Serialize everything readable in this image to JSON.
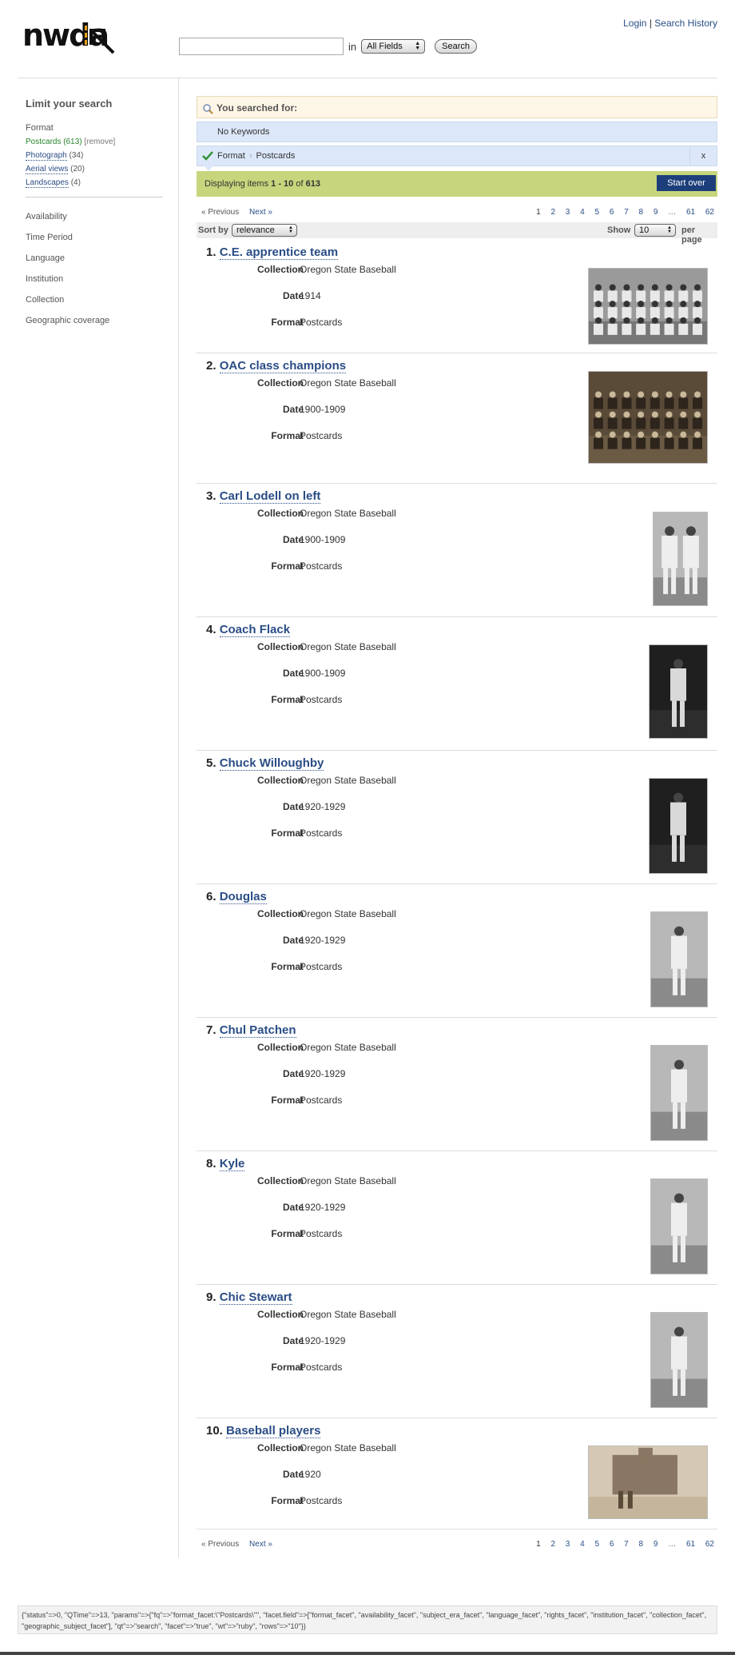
{
  "header": {
    "logo_text": "nwda",
    "search": {
      "value": "",
      "in_label": "in",
      "field": "All Fields",
      "button": "Search"
    },
    "login": "Login",
    "separator": "|",
    "history": "Search History"
  },
  "sidebar": {
    "title": "Limit your search",
    "format": {
      "heading": "Format",
      "items": [
        {
          "label": "Postcards",
          "count": "(613)",
          "remove": "[remove]"
        },
        {
          "label": "Photograph",
          "count": "(34)"
        },
        {
          "label": "Aerial views",
          "count": "(20)"
        },
        {
          "label": "Landscapes",
          "count": "(4)"
        }
      ]
    },
    "other": [
      "Availability",
      "Time Period",
      "Language",
      "Institution",
      "Collection",
      "Geographic coverage"
    ]
  },
  "constraints": {
    "searched_for": "You searched for:",
    "keywords": "No Keywords",
    "facet_name": "Format",
    "facet_value": "Postcards",
    "remove_x": "x",
    "display_prefix": "Displaying items ",
    "display_range": "1 - 10",
    "display_of": " of ",
    "display_total": "613",
    "start_over": "Start over"
  },
  "pager": {
    "prev": "« Previous",
    "next": "Next »",
    "pages": [
      "1",
      "2",
      "3",
      "4",
      "5",
      "6",
      "7",
      "8",
      "9",
      "…",
      "61",
      "62"
    ]
  },
  "sort": {
    "label": "Sort by",
    "value": "relevance",
    "show": "Show",
    "per_value": "10",
    "per_label": "per page"
  },
  "field_labels": {
    "collection": "Collection",
    "date": "Date",
    "format": "Format"
  },
  "results": [
    {
      "num": "1.",
      "title": "C.E. apprentice team",
      "collection": "Oregon State Baseball",
      "date": "1914",
      "format": "Postcards",
      "thumb": "team-photo"
    },
    {
      "num": "2.",
      "title": "OAC class champions",
      "collection": "Oregon State Baseball",
      "date": "1900-1909",
      "format": "Postcards",
      "thumb": "team-photo-sepia"
    },
    {
      "num": "3.",
      "title": "Carl Lodell on left",
      "collection": "Oregon State Baseball",
      "date": "1900-1909",
      "format": "Postcards",
      "thumb": "two-players"
    },
    {
      "num": "4.",
      "title": "Coach Flack",
      "collection": "Oregon State Baseball",
      "date": "1900-1909",
      "format": "Postcards",
      "thumb": "player-dark"
    },
    {
      "num": "5.",
      "title": "Chuck Willoughby",
      "collection": "Oregon State Baseball",
      "date": "1920-1929",
      "format": "Postcards",
      "thumb": "player-dark"
    },
    {
      "num": "6.",
      "title": "Douglas",
      "collection": "Oregon State Baseball",
      "date": "1920-1929",
      "format": "Postcards",
      "thumb": "player-light"
    },
    {
      "num": "7.",
      "title": "Chul Patchen",
      "collection": "Oregon State Baseball",
      "date": "1920-1929",
      "format": "Postcards",
      "thumb": "player-light"
    },
    {
      "num": "8.",
      "title": "Kyle",
      "collection": "Oregon State Baseball",
      "date": "1920-1929",
      "format": "Postcards",
      "thumb": "player-light"
    },
    {
      "num": "9.",
      "title": "Chic Stewart",
      "collection": "Oregon State Baseball",
      "date": "1920-1929",
      "format": "Postcards",
      "thumb": "player-light"
    },
    {
      "num": "10.",
      "title": "Baseball players",
      "collection": "Oregon State Baseball",
      "date": "1920",
      "format": "Postcards",
      "thumb": "building-sepia"
    }
  ],
  "footer_text": "{\"status\"=>0, \"QTime\"=>13, \"params\"=>{\"fq\"=>\"format_facet:\\\"Postcards\\\"\", \"facet.field\"=>[\"format_facet\", \"availability_facet\", \"subject_era_facet\", \"language_facet\", \"rights_facet\", \"institution_facet\", \"collection_facet\", \"geographic_subject_facet\"], \"qt\"=>\"search\", \"facet\"=>\"true\", \"wt\"=>\"ruby\", \"rows\"=>\"10\"}}"
}
